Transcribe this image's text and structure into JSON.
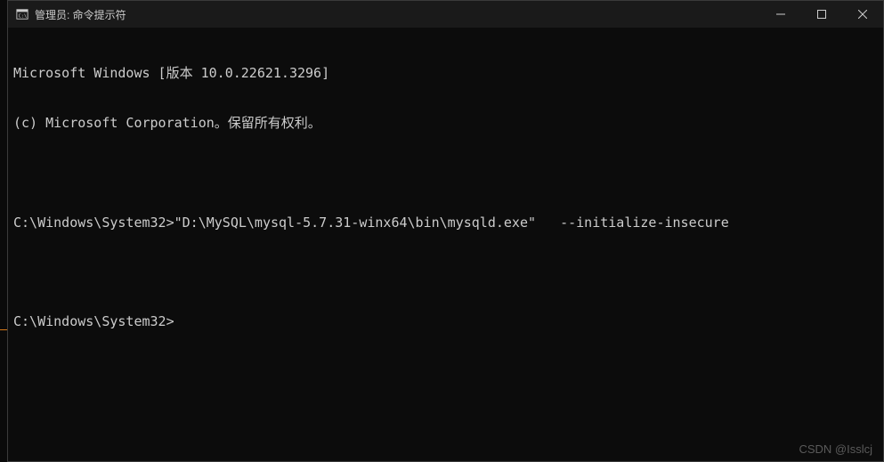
{
  "titlebar": {
    "title": "管理员: 命令提示符"
  },
  "terminal": {
    "lines": [
      "Microsoft Windows [版本 10.0.22621.3296]",
      "(c) Microsoft Corporation。保留所有权利。",
      "",
      "C:\\Windows\\System32>\"D:\\MySQL\\mysql-5.7.31-winx64\\bin\\mysqld.exe\"   --initialize-insecure",
      "",
      "C:\\Windows\\System32>"
    ]
  },
  "watermark": "CSDN @Isslcj"
}
